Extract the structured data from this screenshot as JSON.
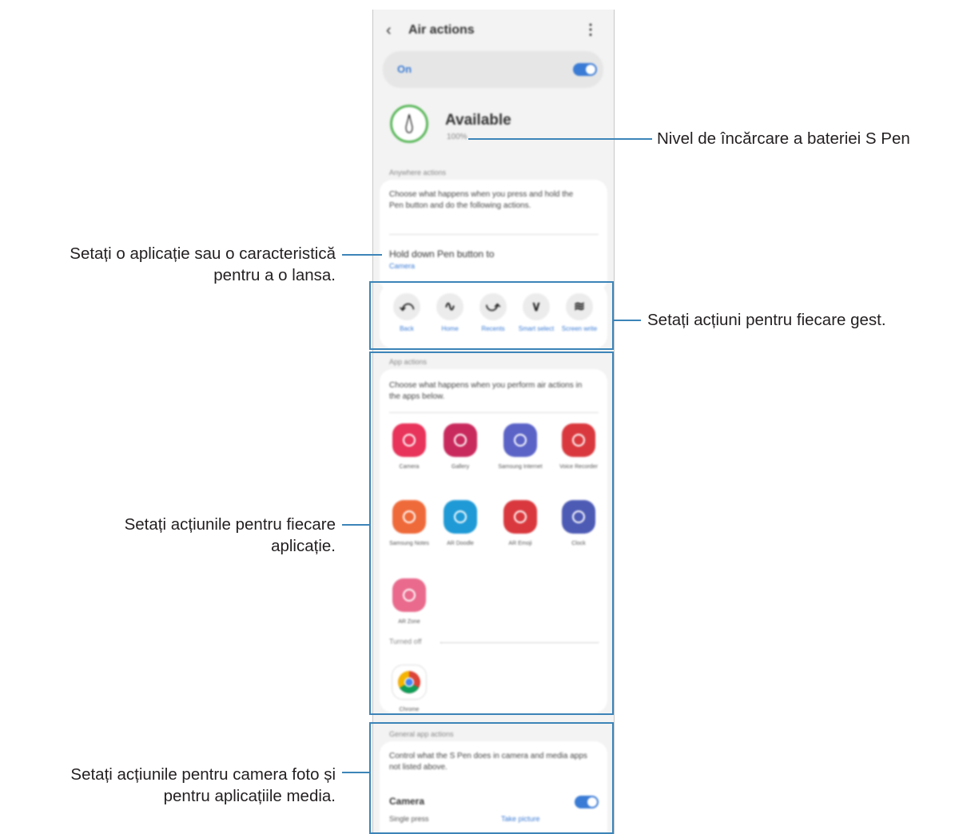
{
  "screen": {
    "title": "Air actions",
    "back_icon": "‹",
    "more_icon": "⋮",
    "on_label": "On",
    "status": "Available",
    "battery": "100%",
    "anywhere_header": "Anywhere actions",
    "anywhere_desc": "Choose what happens when you press and hold the Pen button and do the following actions.",
    "hold_title": "Hold down Pen button to",
    "hold_value": "Camera",
    "gestures": [
      {
        "glyph": "⤺",
        "label": "Back"
      },
      {
        "glyph": "∿",
        "label": "Home"
      },
      {
        "glyph": "⤻",
        "label": "Recents"
      },
      {
        "glyph": "∨",
        "label": "Smart select"
      },
      {
        "glyph": "≋",
        "label": "Screen write"
      }
    ],
    "app_actions_header": "App actions",
    "app_actions_desc": "Choose what happens when you perform air actions in the apps below.",
    "apps": [
      {
        "label": "Camera",
        "color": "#e8335a"
      },
      {
        "label": "Gallery",
        "color": "#c92a5e"
      },
      {
        "label": "Samsung Internet",
        "color": "#5b63c7"
      },
      {
        "label": "Voice Recorder",
        "color": "#d9393e"
      },
      {
        "label": "Samsung Notes",
        "color": "#ef6a3a"
      },
      {
        "label": "AR Doodle",
        "color": "#1f9ad6"
      },
      {
        "label": "AR Emoji",
        "color": "#d9393e"
      },
      {
        "label": "Clock",
        "color": "#4d5bb5"
      },
      {
        "label": "AR Zone",
        "color": "#e96a8c"
      }
    ],
    "turned_off_header": "Turned off",
    "off_apps": [
      {
        "label": "Chrome"
      }
    ],
    "general_header": "General app actions",
    "general_desc": "Control what the S Pen does in camera and media apps not listed above.",
    "general_item": "Camera",
    "single_press": "Single press",
    "single_press_value": "Take picture",
    "accent_color": "#3a7bd5"
  },
  "annotations": {
    "battery": "Nivel de încărcare a bateriei S Pen",
    "launch_line1": "Setați o aplicație sau o caracteristică",
    "launch_line2": "pentru a o lansa.",
    "gesture": "Setați acțiuni pentru fiecare gest.",
    "apps_line1": "Setați acțiunile pentru fiecare",
    "apps_line2": "aplicație.",
    "media_line1": "Setați acțiunile pentru camera foto și",
    "media_line2": "pentru aplicațiile media."
  }
}
